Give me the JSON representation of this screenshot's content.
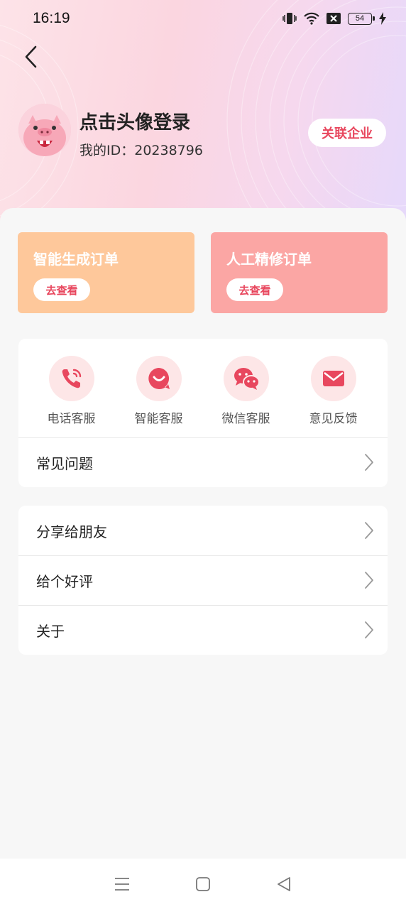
{
  "status": {
    "time": "16:19",
    "battery": "54"
  },
  "profile": {
    "login_prompt": "点击头像登录",
    "id_label": "我的ID：20238796",
    "link_company": "关联企业"
  },
  "orders": [
    {
      "title": "智能生成订单",
      "button": "去查看"
    },
    {
      "title": "人工精修订单",
      "button": "去查看"
    }
  ],
  "services": [
    {
      "label": "电话客服",
      "icon": "phone-icon"
    },
    {
      "label": "智能客服",
      "icon": "smile-chat-icon"
    },
    {
      "label": "微信客服",
      "icon": "wechat-icon"
    },
    {
      "label": "意见反馈",
      "icon": "mail-icon"
    }
  ],
  "faq": {
    "label": "常见问题"
  },
  "menu": [
    {
      "label": "分享给朋友"
    },
    {
      "label": "给个好评"
    },
    {
      "label": "关于"
    }
  ],
  "colors": {
    "accent": "#e8475e",
    "smart_card": "#fec89b",
    "manual_card": "#fba6a4"
  }
}
